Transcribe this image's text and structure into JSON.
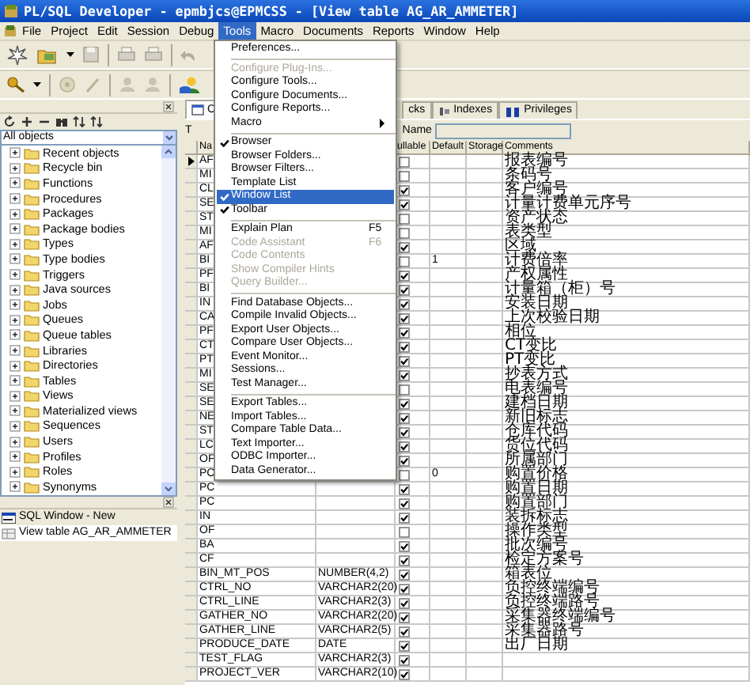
{
  "window": {
    "title": "PL/SQL Developer - epmbjcs@EPMCSS - [View table AG_AR_AMMETER]"
  },
  "menu_bar": [
    {
      "label": "File",
      "selected": false
    },
    {
      "label": "Project",
      "selected": false
    },
    {
      "label": "Edit",
      "selected": false
    },
    {
      "label": "Session",
      "selected": false
    },
    {
      "label": "Debug",
      "selected": false
    },
    {
      "label": "Tools",
      "selected": true
    },
    {
      "label": "Macro",
      "selected": false
    },
    {
      "label": "Documents",
      "selected": false
    },
    {
      "label": "Reports",
      "selected": false
    },
    {
      "label": "Window",
      "selected": false
    },
    {
      "label": "Help",
      "selected": false
    }
  ],
  "tools_menu": [
    {
      "kind": "item",
      "label": "Preferences...",
      "disabled": false,
      "checked": false,
      "selected": false
    },
    {
      "kind": "separator"
    },
    {
      "kind": "item",
      "label": "Configure Plug-Ins...",
      "disabled": true,
      "checked": false,
      "selected": false
    },
    {
      "kind": "item",
      "label": "Configure Tools...",
      "disabled": false,
      "checked": false,
      "selected": false
    },
    {
      "kind": "item",
      "label": "Configure Documents...",
      "disabled": false,
      "checked": false,
      "selected": false
    },
    {
      "kind": "item",
      "label": "Configure Reports...",
      "disabled": false,
      "checked": false,
      "selected": false
    },
    {
      "kind": "submenu",
      "label": "Macro",
      "disabled": false,
      "checked": false,
      "selected": false
    },
    {
      "kind": "separator"
    },
    {
      "kind": "item",
      "label": "Browser",
      "disabled": false,
      "checked": true,
      "selected": false
    },
    {
      "kind": "item",
      "label": "Browser Folders...",
      "disabled": false,
      "checked": false,
      "selected": false
    },
    {
      "kind": "item",
      "label": "Browser Filters...",
      "disabled": false,
      "checked": false,
      "selected": false
    },
    {
      "kind": "item",
      "label": "Template List",
      "disabled": false,
      "checked": false,
      "selected": false
    },
    {
      "kind": "item",
      "label": "Window List",
      "disabled": false,
      "checked": true,
      "selected": true
    },
    {
      "kind": "item",
      "label": "Toolbar",
      "disabled": false,
      "checked": true,
      "selected": false
    },
    {
      "kind": "separator"
    },
    {
      "kind": "item",
      "label": "Explain Plan",
      "shortcut": "F5",
      "disabled": false,
      "checked": false,
      "selected": false
    },
    {
      "kind": "item",
      "label": "Code Assistant",
      "shortcut": "F6",
      "disabled": true,
      "checked": false,
      "selected": false
    },
    {
      "kind": "item",
      "label": "Code Contents",
      "disabled": true,
      "checked": false,
      "selected": false
    },
    {
      "kind": "item",
      "label": "Show Compiler Hints",
      "disabled": true,
      "checked": false,
      "selected": false
    },
    {
      "kind": "item",
      "label": "Query Builder...",
      "disabled": true,
      "checked": false,
      "selected": false
    },
    {
      "kind": "separator"
    },
    {
      "kind": "item",
      "label": "Find Database Objects...",
      "disabled": false,
      "checked": false,
      "selected": false
    },
    {
      "kind": "item",
      "label": "Compile Invalid Objects...",
      "disabled": false,
      "checked": false,
      "selected": false
    },
    {
      "kind": "item",
      "label": "Export User Objects...",
      "disabled": false,
      "checked": false,
      "selected": false
    },
    {
      "kind": "item",
      "label": "Compare User Objects...",
      "disabled": false,
      "checked": false,
      "selected": false
    },
    {
      "kind": "item",
      "label": "Event Monitor...",
      "disabled": false,
      "checked": false,
      "selected": false
    },
    {
      "kind": "item",
      "label": "Sessions...",
      "disabled": false,
      "checked": false,
      "selected": false
    },
    {
      "kind": "item",
      "label": "Test Manager...",
      "disabled": false,
      "checked": false,
      "selected": false
    },
    {
      "kind": "separator"
    },
    {
      "kind": "item",
      "label": "Export Tables...",
      "disabled": false,
      "checked": false,
      "selected": false
    },
    {
      "kind": "item",
      "label": "Import Tables...",
      "disabled": false,
      "checked": false,
      "selected": false
    },
    {
      "kind": "item",
      "label": "Compare Table Data...",
      "disabled": false,
      "checked": false,
      "selected": false
    },
    {
      "kind": "item",
      "label": "Text Importer...",
      "disabled": false,
      "checked": false,
      "selected": false
    },
    {
      "kind": "item",
      "label": "ODBC Importer...",
      "disabled": false,
      "checked": false,
      "selected": false
    },
    {
      "kind": "item",
      "label": "Data Generator...",
      "disabled": false,
      "checked": false,
      "selected": false
    }
  ],
  "browser": {
    "filter": "All objects",
    "tree": [
      {
        "label": "Recent objects",
        "expanded": false
      },
      {
        "label": "Recycle bin",
        "expanded": false
      },
      {
        "label": "Functions",
        "expanded": false
      },
      {
        "label": "Procedures",
        "expanded": false
      },
      {
        "label": "Packages",
        "expanded": false
      },
      {
        "label": "Package bodies",
        "expanded": false
      },
      {
        "label": "Types",
        "expanded": false
      },
      {
        "label": "Type bodies",
        "expanded": false
      },
      {
        "label": "Triggers",
        "expanded": false
      },
      {
        "label": "Java sources",
        "expanded": false
      },
      {
        "label": "Jobs",
        "expanded": false
      },
      {
        "label": "Queues",
        "expanded": false
      },
      {
        "label": "Queue tables",
        "expanded": false
      },
      {
        "label": "Libraries",
        "expanded": false
      },
      {
        "label": "Directories",
        "expanded": false
      },
      {
        "label": "Tables",
        "expanded": false
      },
      {
        "label": "Views",
        "expanded": false
      },
      {
        "label": "Materialized views",
        "expanded": false
      },
      {
        "label": "Sequences",
        "expanded": false
      },
      {
        "label": "Users",
        "expanded": false
      },
      {
        "label": "Profiles",
        "expanded": false
      },
      {
        "label": "Roles",
        "expanded": false
      },
      {
        "label": "Synonyms",
        "expanded": false
      }
    ]
  },
  "window_list": [
    {
      "label": "SQL Window - New",
      "selected": false
    },
    {
      "label": "View table AG_AR_AMMETER",
      "selected": true
    }
  ],
  "editor": {
    "tabs": [
      {
        "label": "C",
        "selected": true
      },
      {
        "label": "cks",
        "selected": false
      },
      {
        "label": "Indexes",
        "selected": false
      },
      {
        "label": "Privileges",
        "selected": false
      }
    ],
    "cut_label": "T",
    "name_field": {
      "label": "Name",
      "disabled": true
    },
    "header": {
      "name": "Na",
      "nullable": "ullable",
      "default": "Default",
      "storage": "Storage",
      "comments": "Comments"
    },
    "rows": [
      {
        "selected": true,
        "name": "AF",
        "nullable": false,
        "comment": "报表编号"
      },
      {
        "selected": false,
        "name": "MI",
        "nullable": false,
        "comment": "条码号"
      },
      {
        "selected": false,
        "name": "CL",
        "nullable": true,
        "comment": "客户编号"
      },
      {
        "selected": false,
        "name": "SE",
        "nullable": true,
        "comment": "计量计费单元序号"
      },
      {
        "selected": false,
        "name": "ST",
        "nullable": false,
        "comment": "资产状态"
      },
      {
        "selected": false,
        "name": "MI",
        "nullable": false,
        "comment": "表类型"
      },
      {
        "selected": false,
        "name": "AF",
        "nullable": true,
        "comment": "区域"
      },
      {
        "selected": false,
        "name": "BI",
        "nullable": false,
        "default": "1",
        "comment": "计费倍率"
      },
      {
        "selected": false,
        "name": "PF",
        "nullable": true,
        "comment": "产权属性"
      },
      {
        "selected": false,
        "name": "BI",
        "nullable": true,
        "comment": "计量箱（柜）号"
      },
      {
        "selected": false,
        "name": "IN",
        "nullable": true,
        "comment": "安装日期"
      },
      {
        "selected": false,
        "name": "CA",
        "nullable": true,
        "comment": "上次校验日期"
      },
      {
        "selected": false,
        "name": "PF",
        "nullable": true,
        "comment": "相位"
      },
      {
        "selected": false,
        "name": "CT",
        "nullable": true,
        "comment": "CT变比"
      },
      {
        "selected": false,
        "name": "PT",
        "nullable": true,
        "comment": "PT变比"
      },
      {
        "selected": false,
        "name": "MI",
        "nullable": true,
        "comment": "抄表方式"
      },
      {
        "selected": false,
        "name": "SE",
        "nullable": false,
        "comment": "电表编号"
      },
      {
        "selected": false,
        "name": "SE",
        "nullable": true,
        "comment": "建档日期"
      },
      {
        "selected": false,
        "name": "NE",
        "nullable": true,
        "comment": "新旧标志"
      },
      {
        "selected": false,
        "name": "ST",
        "nullable": true,
        "comment": "仓库代码"
      },
      {
        "selected": false,
        "name": "LC",
        "nullable": true,
        "comment": "货位代码"
      },
      {
        "selected": false,
        "name": "OF",
        "nullable": true,
        "comment": "所属部门"
      },
      {
        "selected": false,
        "name": "PC",
        "nullable": false,
        "default": "0",
        "comment": "购置价格"
      },
      {
        "selected": false,
        "name": "PC",
        "nullable": true,
        "comment": "购置日期"
      },
      {
        "selected": false,
        "name": "PC",
        "nullable": true,
        "comment": "购置部门"
      },
      {
        "selected": false,
        "name": "IN",
        "nullable": true,
        "comment": "装拆标志"
      },
      {
        "selected": false,
        "name": "OF",
        "nullable": false,
        "comment": "操作类型"
      },
      {
        "selected": false,
        "name": "BA",
        "nullable": true,
        "comment": "批次编号"
      },
      {
        "selected": false,
        "name": "CF",
        "nullable": true,
        "comment": "检定方案号"
      },
      {
        "selected": false,
        "name": "BIN_MT_POS",
        "type": "NUMBER(4,2)",
        "nullable": true,
        "comment": "箱表位"
      },
      {
        "selected": false,
        "name": "CTRL_NO",
        "type": "VARCHAR2(20)",
        "nullable": true,
        "comment": "负控终端编号"
      },
      {
        "selected": false,
        "name": "CTRL_LINE",
        "type": "VARCHAR2(3)",
        "nullable": true,
        "comment": "负控终端路号"
      },
      {
        "selected": false,
        "name": "GATHER_NO",
        "type": "VARCHAR2(20)",
        "nullable": true,
        "comment": "采集器终端编号"
      },
      {
        "selected": false,
        "name": "GATHER_LINE",
        "type": "VARCHAR2(5)",
        "nullable": true,
        "comment": "采集器路号"
      },
      {
        "selected": false,
        "name": "PRODUCE_DATE",
        "type": "DATE",
        "nullable": true,
        "comment": "出厂日期"
      },
      {
        "selected": false,
        "name": "TEST_FLAG",
        "type": "VARCHAR2(3)",
        "nullable": true
      },
      {
        "selected": false,
        "name": "PROJECT_VER",
        "type": "VARCHAR2(10)",
        "nullable": true
      }
    ]
  }
}
